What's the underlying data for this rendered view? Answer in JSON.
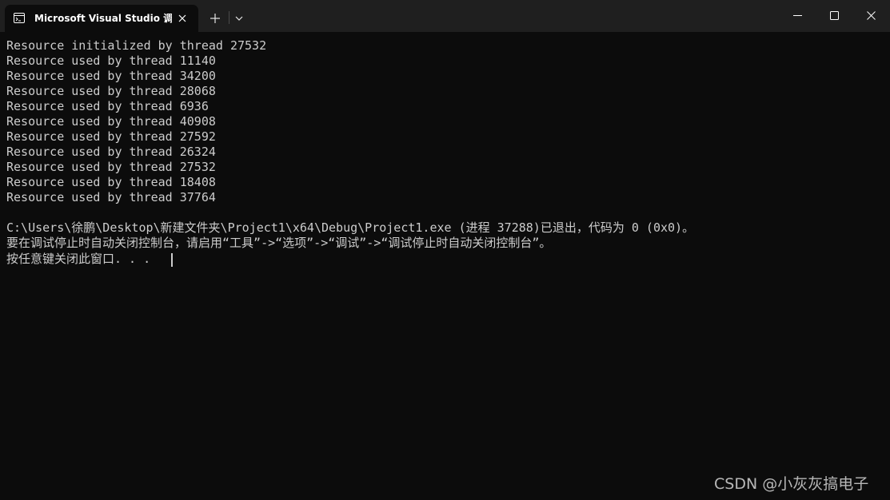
{
  "window": {
    "tab_title": "Microsoft Visual Studio 调试控",
    "tab_icon": "terminal-icon",
    "close_tab_icon": "close-icon",
    "new_tab_icon": "plus-icon",
    "dropdown_icon": "chevron-down-icon",
    "controls": [
      "minimize-icon",
      "maximize-icon",
      "close-icon"
    ]
  },
  "console": {
    "lines": [
      "Resource initialized by thread 27532",
      "Resource used by thread 11140",
      "Resource used by thread 34200",
      "Resource used by thread 28068",
      "Resource used by thread 6936",
      "Resource used by thread 40908",
      "Resource used by thread 27592",
      "Resource used by thread 26324",
      "Resource used by thread 27532",
      "Resource used by thread 18408",
      "Resource used by thread 37764",
      "",
      "C:\\Users\\徐鹏\\Desktop\\新建文件夹\\Project1\\x64\\Debug\\Project1.exe (进程 37288)已退出，代码为 0 (0x0)。",
      "要在调试停止时自动关闭控制台，请启用“工具”->“选项”->“调试”->“调试停止时自动关闭控制台”。",
      "按任意键关闭此窗口. . ."
    ]
  },
  "watermark": "CSDN @小灰灰搞电子",
  "colors": {
    "background": "#0c0c0c",
    "titlebar": "#1f1f1f",
    "text": "#cccccc"
  }
}
